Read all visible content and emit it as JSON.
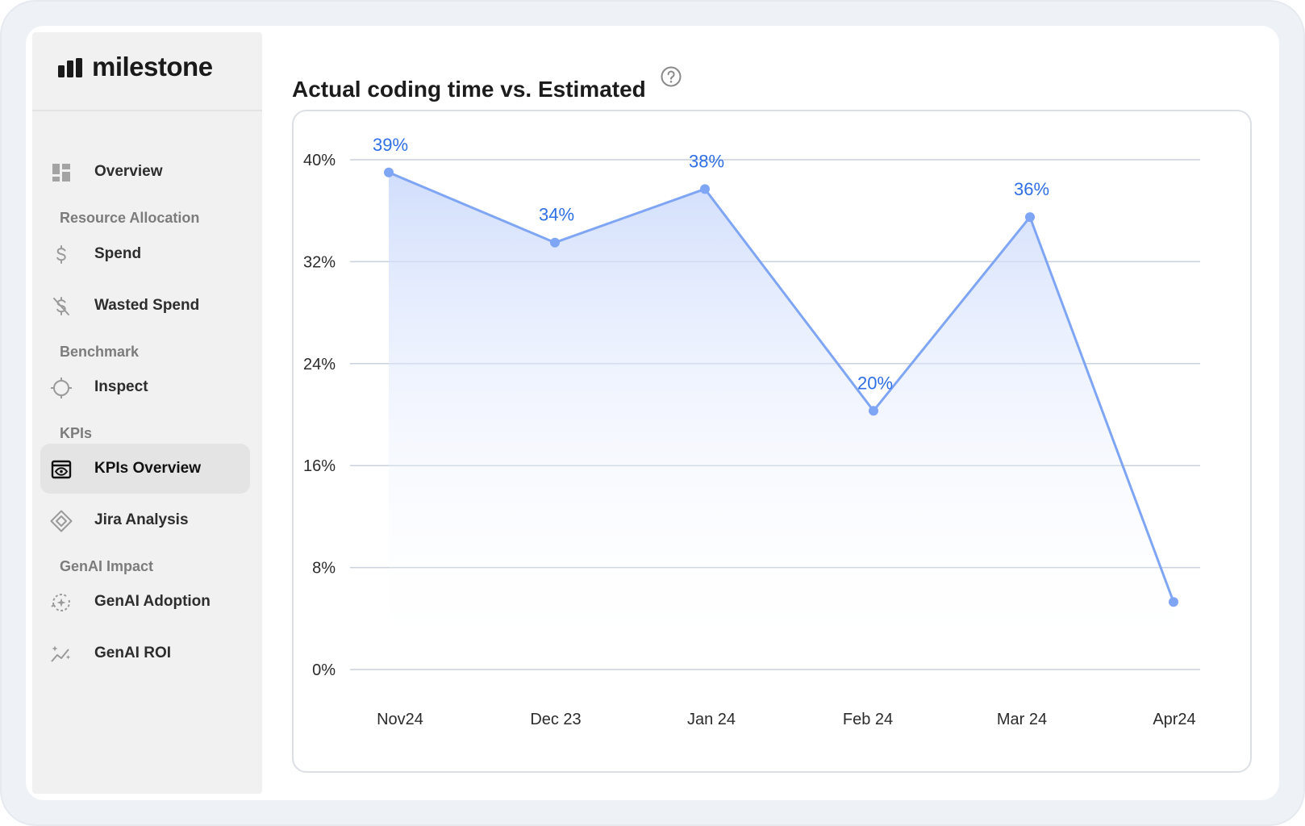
{
  "app": {
    "brand_name": "milestone"
  },
  "sidebar": {
    "items": [
      {
        "type": "item",
        "label": "Overview",
        "icon": "dashboard-icon"
      },
      {
        "type": "section",
        "label": "Resource Allocation"
      },
      {
        "type": "item",
        "label": "Spend",
        "icon": "dollar-icon"
      },
      {
        "type": "item",
        "label": "Wasted Spend",
        "icon": "dollar-off-icon"
      },
      {
        "type": "section",
        "label": "Benchmark"
      },
      {
        "type": "item",
        "label": "Inspect",
        "icon": "crosshair-icon"
      },
      {
        "type": "section",
        "label": "KPIs"
      },
      {
        "type": "item",
        "label": "KPIs Overview",
        "icon": "eye-window-icon",
        "active": true
      },
      {
        "type": "item",
        "label": "Jira Analysis",
        "icon": "jira-diamond-icon"
      },
      {
        "type": "section",
        "label": "GenAI Impact"
      },
      {
        "type": "item",
        "label": "GenAI Adoption",
        "icon": "sparkle-cycle-icon"
      },
      {
        "type": "item",
        "label": "GenAI ROI",
        "icon": "sparkle-trend-icon"
      }
    ]
  },
  "main": {
    "title": "Actual coding time vs. Estimated",
    "help_icon": "question-circle-icon"
  },
  "chart_data": {
    "type": "area",
    "x": [
      "Nov24",
      "Dec 23",
      "Jan 24",
      "Feb 24",
      "Mar 24",
      "Apr24"
    ],
    "series": [
      {
        "values": [
          39,
          33.5,
          37.7,
          20.3,
          35.5,
          5.3
        ],
        "data_labels": [
          "39%",
          "34%",
          "38%",
          "20%",
          "36%",
          ""
        ]
      }
    ],
    "yticks": [
      "0%",
      "8%",
      "16%",
      "24%",
      "32%",
      "40%"
    ],
    "ylim": [
      0,
      40
    ],
    "grid": true,
    "colors": {
      "line": "#7fa5f5",
      "label": "#2f6fe4",
      "grid": "#c9d1dc"
    }
  }
}
